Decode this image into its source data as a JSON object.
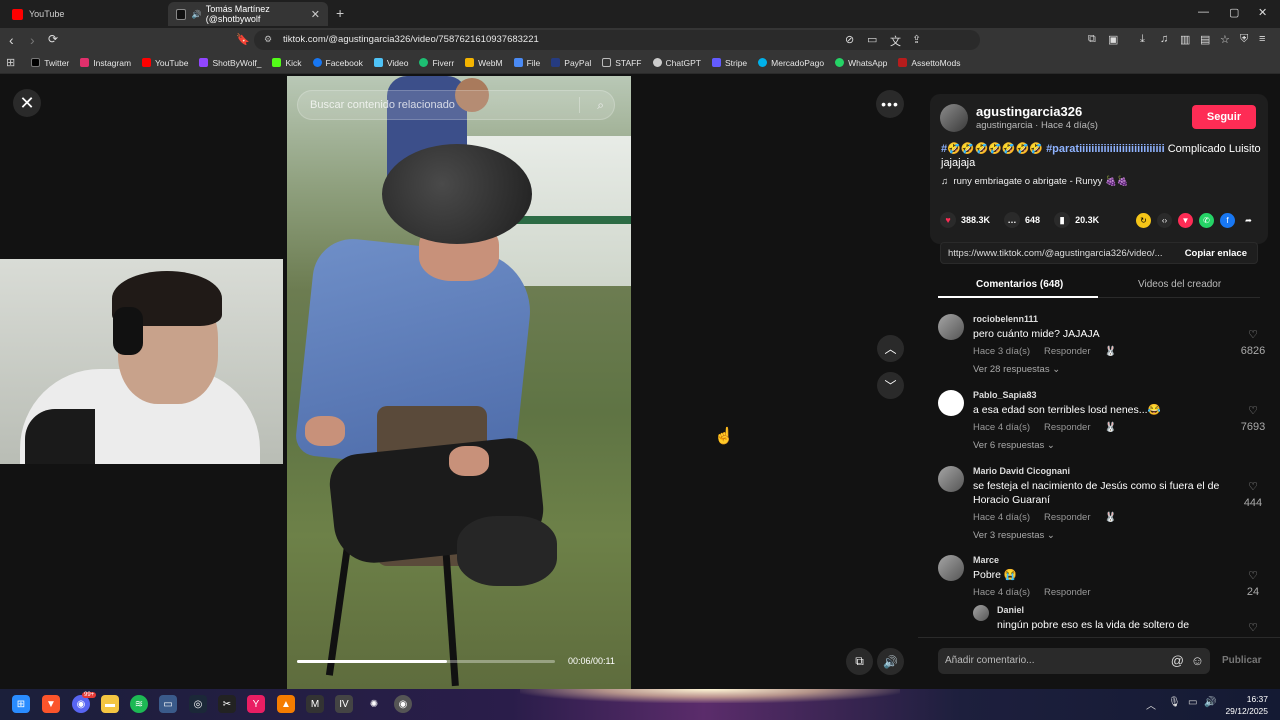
{
  "browser": {
    "tabs": [
      {
        "label": "YouTube",
        "icon": "youtube-icon",
        "color": "#ff0000"
      },
      {
        "label": "Tomás Martínez (@shotbywolf",
        "icon": "tiktok-icon",
        "color": "#ffffff"
      }
    ],
    "url": "tiktok.com/@agustingarcia326/video/7587621610937683221",
    "shield_badge": "2",
    "bookmarks": [
      {
        "label": "Twitter",
        "color": "#000000"
      },
      {
        "label": "Instagram",
        "color": "#e1306c"
      },
      {
        "label": "YouTube",
        "color": "#ff0000"
      },
      {
        "label": "ShotByWolf_",
        "color": "#9146ff"
      },
      {
        "label": "Kick",
        "color": "#53fc18"
      },
      {
        "label": "Facebook",
        "color": "#1877f2"
      },
      {
        "label": "Video",
        "color": "#4fc3f7"
      },
      {
        "label": "Fiverr",
        "color": "#1dbf73"
      },
      {
        "label": "WebM",
        "color": "#f4b400"
      },
      {
        "label": "File",
        "color": "#4a8af4"
      },
      {
        "label": "PayPal",
        "color": "#253b80"
      },
      {
        "label": "STAFF",
        "color": "#888888"
      },
      {
        "label": "ChatGPT",
        "color": "#cccccc"
      },
      {
        "label": "Stripe",
        "color": "#635bff"
      },
      {
        "label": "MercadoPago",
        "color": "#00b1ea"
      },
      {
        "label": "WhatsApp",
        "color": "#25d366"
      },
      {
        "label": "AssettoMods",
        "color": "#b71c1c"
      }
    ]
  },
  "video": {
    "search_placeholder": "Buscar contenido relacionado",
    "timecode": "00:06/00:11",
    "progress": 0.58
  },
  "post": {
    "username": "agustingarcia326",
    "sub": "agustingarcia · Hace 4 día(s)",
    "follow_label": "Seguir",
    "desc_tag1": "#🤣🤣🤣🤣🤣🤣🤣",
    "desc_tag2": "#paratiiiiiiiiiiiiiiiiiiiiiiiiiiii",
    "desc_text": "Complicado Luisito jajajaja",
    "music": "runy embriagate o abrigate - Runyy 🍇🍇",
    "likes": "388.3K",
    "comments": "648",
    "saves": "20.3K",
    "link": "https://www.tiktok.com/@agustingarcia326/video/...",
    "copy_label": "Copiar enlace"
  },
  "tabs": {
    "comments": "Comentarios (648)",
    "creator_videos": "Videos del creador"
  },
  "comments": [
    {
      "user": "rociobelenn111",
      "text": "pero cuánto mide? JAJAJA",
      "time": "Hace 3 día(s)",
      "reply": "Responder",
      "replies": "Ver 28 respuestas ⌄",
      "likes": "6826"
    },
    {
      "user": "Pablo_Sapia83",
      "text": "a esa edad son terribles losd nenes...😂",
      "time": "Hace 4 día(s)",
      "reply": "Responder",
      "replies": "Ver 6 respuestas ⌄",
      "likes": "7693"
    },
    {
      "user": "Mario David Cicognani",
      "text": "se festeja el nacimiento de Jesús como si fuera el de Horacio Guaraní",
      "time": "Hace 4 día(s)",
      "reply": "Responder",
      "replies": "Ver 3 respuestas ⌄",
      "likes": "444"
    },
    {
      "user": "Marce",
      "text": "Pobre 😭",
      "time": "Hace 4 día(s)",
      "reply": "Responder",
      "replies": "",
      "likes": "24"
    },
    {
      "user": "Daniel",
      "text": "ningún pobre eso es la vida de soltero de",
      "time": "",
      "reply": "",
      "replies": "",
      "likes": ""
    }
  ],
  "comment_input": {
    "placeholder": "Añadir comentario...",
    "publish": "Publicar"
  },
  "taskbar": {
    "time": "16:37",
    "date": "29/12/2025",
    "discord_badge": "99+"
  }
}
